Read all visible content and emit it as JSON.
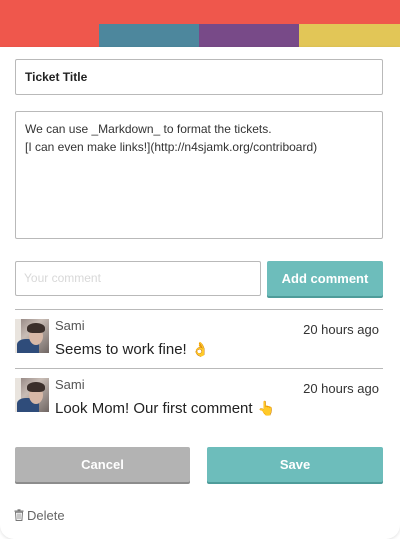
{
  "colors": {
    "top": "#ef574c",
    "segments": [
      "#ef574c",
      "#4d879d",
      "#784a88",
      "#e2c657"
    ],
    "accent": "#6dbdbb",
    "cancel": "#b3b3b3"
  },
  "ticket": {
    "title_value": "Ticket Title",
    "content_lines": [
      "We can use _Markdown_ to format the tickets.",
      "[I can even make links!](http://n4sjamk.org/contriboard)"
    ]
  },
  "comment_form": {
    "placeholder": "Your comment",
    "add_label": "Add comment"
  },
  "comments": [
    {
      "author": "Sami",
      "time": "20 hours ago",
      "text": "Seems to work fine!",
      "emoji": "👌"
    },
    {
      "author": "Sami",
      "time": "20 hours ago",
      "text": "Look Mom! Our first comment",
      "emoji": "👆"
    }
  ],
  "actions": {
    "cancel_label": "Cancel",
    "save_label": "Save",
    "delete_label": "Delete",
    "delete_icon": "trash-icon"
  }
}
